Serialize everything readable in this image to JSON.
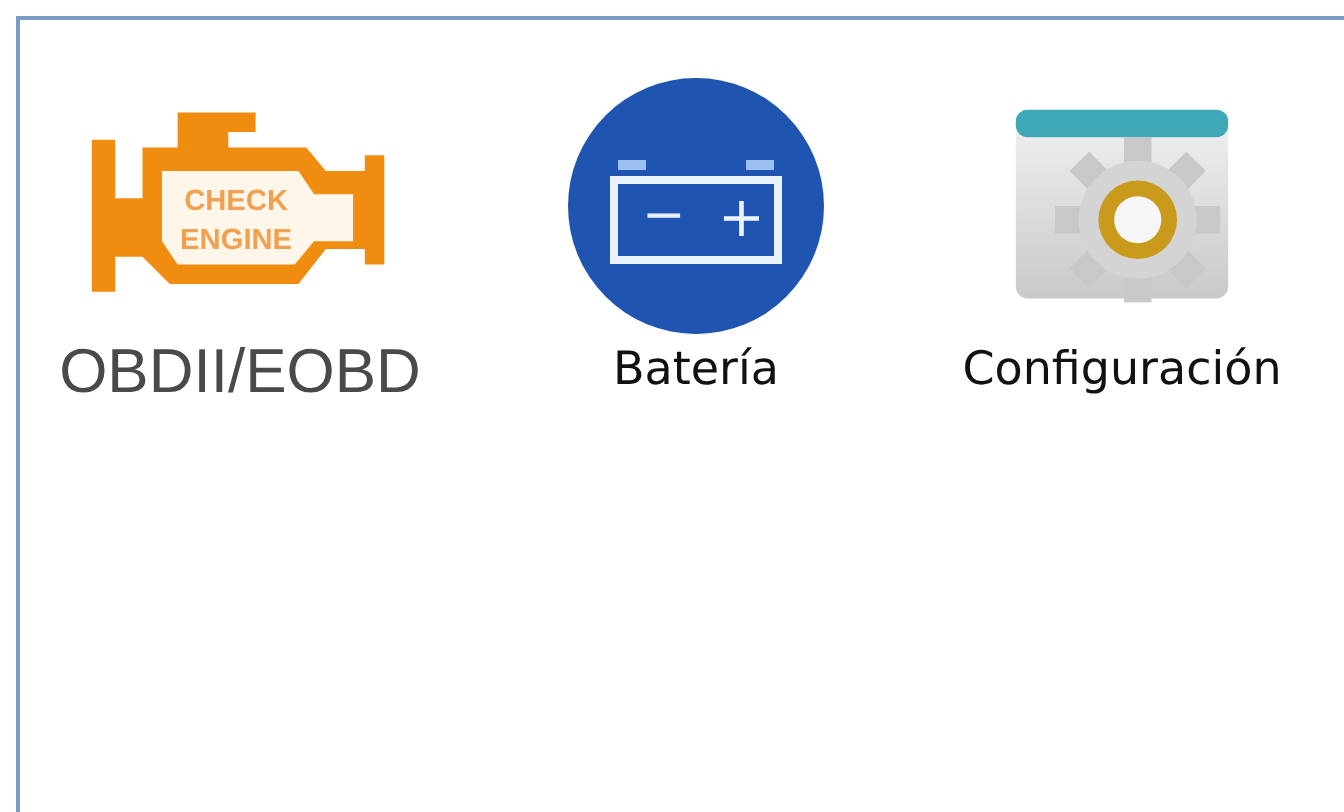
{
  "apps": [
    {
      "kind": "engine",
      "label": "OBDII/EOBD",
      "icon_text": [
        "CHECK",
        "ENGINE"
      ]
    },
    {
      "kind": "battery",
      "label": "Batería",
      "icon_text": [
        "−",
        "+"
      ]
    },
    {
      "kind": "settings",
      "label": "Configuración"
    }
  ]
}
